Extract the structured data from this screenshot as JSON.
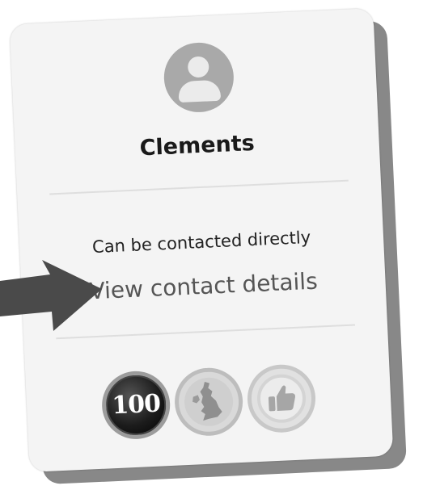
{
  "profile": {
    "name": "Clements",
    "contact_note": "Can be contacted directly",
    "contact_link": "View contact details"
  },
  "badges": [
    {
      "icon": "badge-100-icon",
      "label": "100"
    },
    {
      "icon": "uk-map-icon"
    },
    {
      "icon": "thumbs-up-icon"
    }
  ],
  "colors": {
    "card": "#f4f4f4",
    "shadow": "#888888",
    "avatar": "#a9a9a9",
    "arrow": "#4a4a4a"
  }
}
